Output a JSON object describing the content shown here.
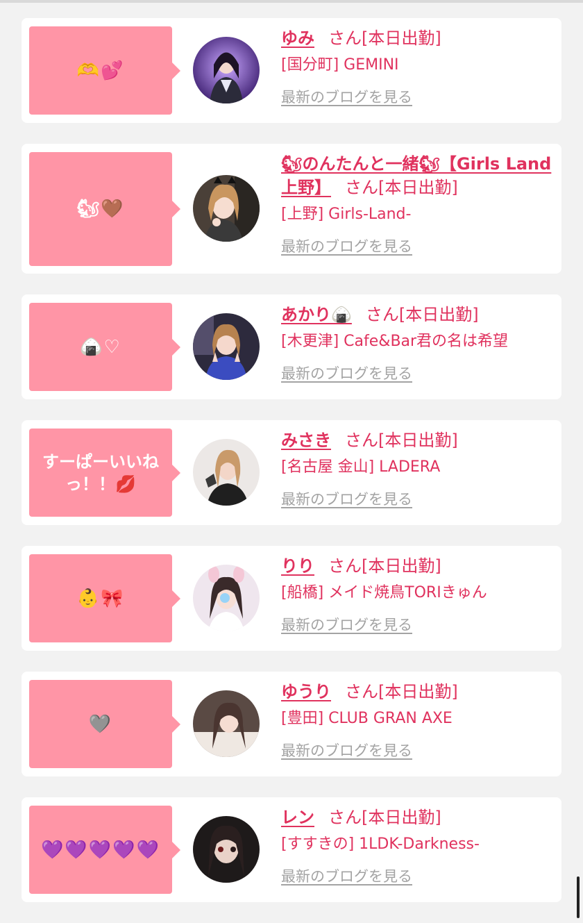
{
  "cards": [
    {
      "message": "🫶💕",
      "name": "ゆみ",
      "status": "さん[本日出勤]",
      "shop": "[国分町] GEMINI",
      "blog_link": "最新のブログを見る"
    },
    {
      "message": "🐿🤎",
      "name": "🐿のんたんと一緒🐿【Girls Land上野】",
      "status": "さん[本日出勤]",
      "shop": "[上野] Girls-Land-",
      "blog_link": "最新のブログを見る"
    },
    {
      "message": "🍙♡",
      "name": "あかり🍙",
      "status": "さん[本日出勤]",
      "shop": "[木更津] Cafe&Bar君の名は希望",
      "blog_link": "最新のブログを見る"
    },
    {
      "message": "すーぱーいいねっ！！💋",
      "name": "みさき",
      "status": "さん[本日出勤]",
      "shop": "[名古屋 金山] LADERA",
      "blog_link": "最新のブログを見る"
    },
    {
      "message": "👶🎀",
      "name": "りり",
      "status": "さん[本日出勤]",
      "shop": "[船橋] メイド焼鳥TORIきゅん",
      "blog_link": "最新のブログを見る"
    },
    {
      "message": "🩶",
      "name": "ゆうり",
      "status": "さん[本日出勤]",
      "shop": "[豊田] CLUB GRAN AXE",
      "blog_link": "最新のブログを見る"
    },
    {
      "message": "💜💜💜💜💜",
      "name": "レン",
      "status": "さん[本日出勤]",
      "shop": "[すすきの] 1LDK-Darkness-",
      "blog_link": "最新のブログを見る"
    }
  ],
  "colors": {
    "bubble": "#ff95a6",
    "name": "#e0325e",
    "blog_link": "#a3a3a3",
    "card": "#ffffff",
    "page": "#f2f2f2"
  }
}
